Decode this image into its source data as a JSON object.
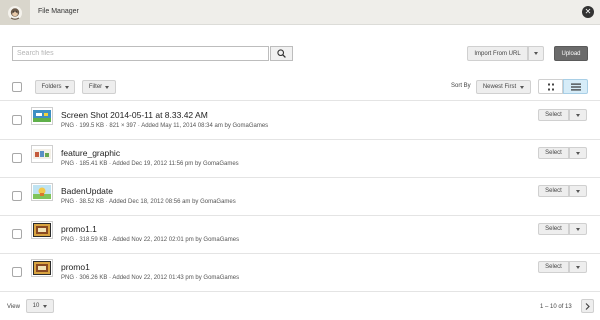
{
  "header": {
    "title": "File Manager"
  },
  "toolbar": {
    "search_placeholder": "Search files",
    "import_label": "Import From URL",
    "upload_label": "Upload"
  },
  "filters": {
    "folders_label": "Folders",
    "filter_label": "Filter",
    "sort_label": "Sort By",
    "sort_value": "Newest First"
  },
  "files": [
    {
      "name": "Screen Shot 2014-05-11 at 8.33.42 AM",
      "meta": "PNG · 199.5 KB · 821 × 397 · Added May 11, 2014 08:34 am by GomaGames",
      "select_label": "Select",
      "thumb": "screenshot"
    },
    {
      "name": "feature_graphic",
      "meta": "PNG · 185.41 KB · Added Dec 19, 2012 11:56 pm by GomaGames",
      "select_label": "Select",
      "thumb": "graphic"
    },
    {
      "name": "BadenUpdate",
      "meta": "PNG · 38.52 KB · Added Dec 18, 2012 08:56 am by GomaGames",
      "select_label": "Select",
      "thumb": "badge"
    },
    {
      "name": "promo1.1",
      "meta": "PNG · 318.59 KB · Added Nov 22, 2012 02:01 pm by GomaGames",
      "select_label": "Select",
      "thumb": "promo"
    },
    {
      "name": "promo1",
      "meta": "PNG · 306.26 KB · Added Nov 22, 2012 01:43 pm by GomaGames",
      "select_label": "Select",
      "thumb": "promo"
    }
  ],
  "footer": {
    "view_label": "View",
    "per_page": "10",
    "pagination": "1 – 10 of 13"
  },
  "colors": {
    "accent": "#d6ecf8",
    "upload": "#6b6b6b",
    "header_bg": "#efeeea"
  }
}
